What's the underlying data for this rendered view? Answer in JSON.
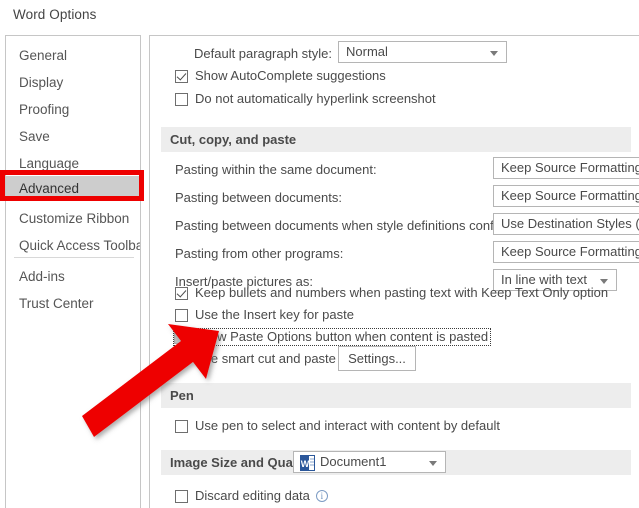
{
  "dialog": {
    "title": "Word Options"
  },
  "sidebar": {
    "items": [
      {
        "label": "General",
        "selected": false
      },
      {
        "label": "Display",
        "selected": false
      },
      {
        "label": "Proofing",
        "selected": false
      },
      {
        "label": "Save",
        "selected": false
      },
      {
        "label": "Language",
        "selected": false
      },
      {
        "label": "Advanced",
        "selected": true
      },
      {
        "label": "Customize Ribbon",
        "selected": false
      },
      {
        "label": "Quick Access Toolbar",
        "selected": false
      },
      {
        "label": "Add-ins",
        "selected": false
      },
      {
        "label": "Trust Center",
        "selected": false
      }
    ]
  },
  "content": {
    "default_paragraph_style": {
      "label": "Default paragraph style:",
      "value": "Normal"
    },
    "top_checkboxes": [
      {
        "label": "Show AutoComplete suggestions",
        "state": "checked"
      },
      {
        "label": "Do not automatically hyperlink screenshot",
        "state": "unchecked"
      }
    ],
    "cut_copy_paste": {
      "header": "Cut, copy, and paste",
      "fields": [
        {
          "label": "Pasting within the same document:",
          "value": "Keep Source Formatting (Default)"
        },
        {
          "label": "Pasting between documents:",
          "value": "Keep Source Formatting (Default)"
        },
        {
          "label": "Pasting between documents when style definitions conflict:",
          "value": "Use Destination Styles (Default)"
        },
        {
          "label": "Pasting from other programs:",
          "value": "Keep Source Formatting (Default)"
        },
        {
          "label": "Insert/paste pictures as:",
          "value": "In line with text"
        }
      ],
      "checkboxes": [
        {
          "label": "Keep bullets and numbers when pasting text with Keep Text Only option",
          "state": "checked",
          "focused": false
        },
        {
          "label": "Use the Insert key for paste",
          "state": "unchecked",
          "focused": false
        },
        {
          "label": "Show Paste Options button when content is pasted",
          "state": "filled",
          "focused": true
        },
        {
          "label": "Use smart cut and paste",
          "state": "checked",
          "focused": false,
          "info": true
        }
      ],
      "settings_button": "Settings..."
    },
    "pen": {
      "header": "Pen",
      "checkboxes": [
        {
          "label": "Use pen to select and interact with content by default",
          "state": "unchecked"
        }
      ]
    },
    "image_size_and_quality": {
      "header": "Image Size and Quality",
      "document_selector": "Document1",
      "checkboxes": [
        {
          "label": "Discard editing data",
          "state": "unchecked",
          "info": true
        }
      ]
    }
  },
  "annotations": {
    "highlight_color": "#ee0000",
    "highlighted_sidebar_item": "Advanced",
    "arrow_target": "Show Paste Options button when content is pasted"
  }
}
